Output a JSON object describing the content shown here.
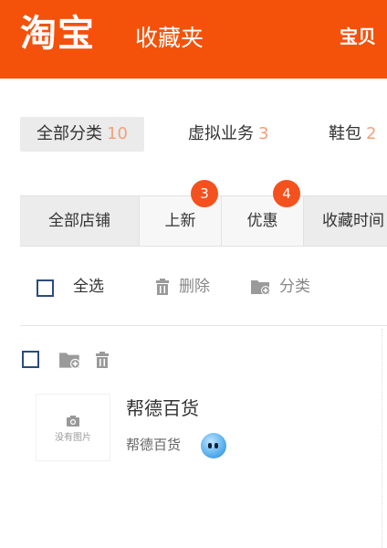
{
  "header": {
    "logo_text": "淘宝",
    "title": "收藏夹",
    "right_link": "宝贝",
    "brand_color": "#f4510b"
  },
  "category_tabs": [
    {
      "label": "全部分类",
      "count": "10"
    },
    {
      "label": "虚拟业务",
      "count": "3"
    },
    {
      "label": "鞋包",
      "count": "2"
    }
  ],
  "store_tabs": [
    {
      "label": "全部店铺"
    },
    {
      "label": "上新",
      "badge": "3"
    },
    {
      "label": "优惠",
      "badge": "4"
    },
    {
      "label": "收藏时间"
    }
  ],
  "toolbar": {
    "select_all": "全选",
    "delete": "删除",
    "categorize": "分类"
  },
  "store_item": {
    "thumb_placeholder": "没有图片",
    "name": "帮德百货",
    "seller_name": "帮德百货"
  },
  "icons": [
    "folder-plus-icon",
    "trash-icon",
    "camera-icon",
    "wangwang-chat-icon"
  ]
}
